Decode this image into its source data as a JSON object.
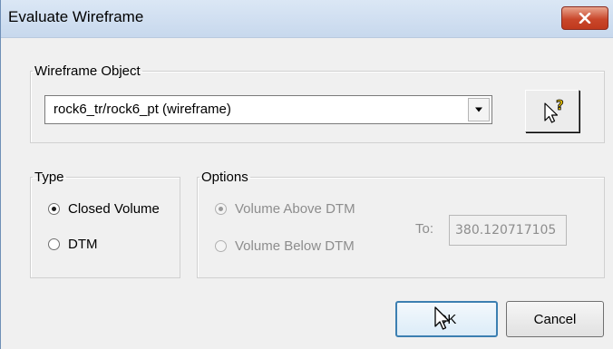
{
  "window": {
    "title": "Evaluate Wireframe"
  },
  "icons": {
    "close": "close-x-icon",
    "dropdown": "chevron-down-icon",
    "pick": "pick-cursor-help-icon",
    "pointer": "mouse-pointer-icon"
  },
  "wireframe_object": {
    "legend": "Wireframe Object",
    "selected_value": "rock6_tr/rock6_pt (wireframe)"
  },
  "type_group": {
    "legend": "Type",
    "options": [
      {
        "label": "Closed Volume",
        "checked": true
      },
      {
        "label": "DTM",
        "checked": false
      }
    ]
  },
  "options_group": {
    "legend": "Options",
    "options": [
      {
        "label": "Volume Above DTM",
        "checked": true,
        "enabled": false
      },
      {
        "label": "Volume Below DTM",
        "checked": false,
        "enabled": false
      }
    ],
    "to_label": "To:",
    "to_value": "380.120717105"
  },
  "buttons": {
    "ok": "OK",
    "cancel": "Cancel"
  },
  "colors": {
    "titlebar": "#c7d8ed",
    "close": "#c9472b",
    "default_button_border": "#3c7fb1"
  }
}
